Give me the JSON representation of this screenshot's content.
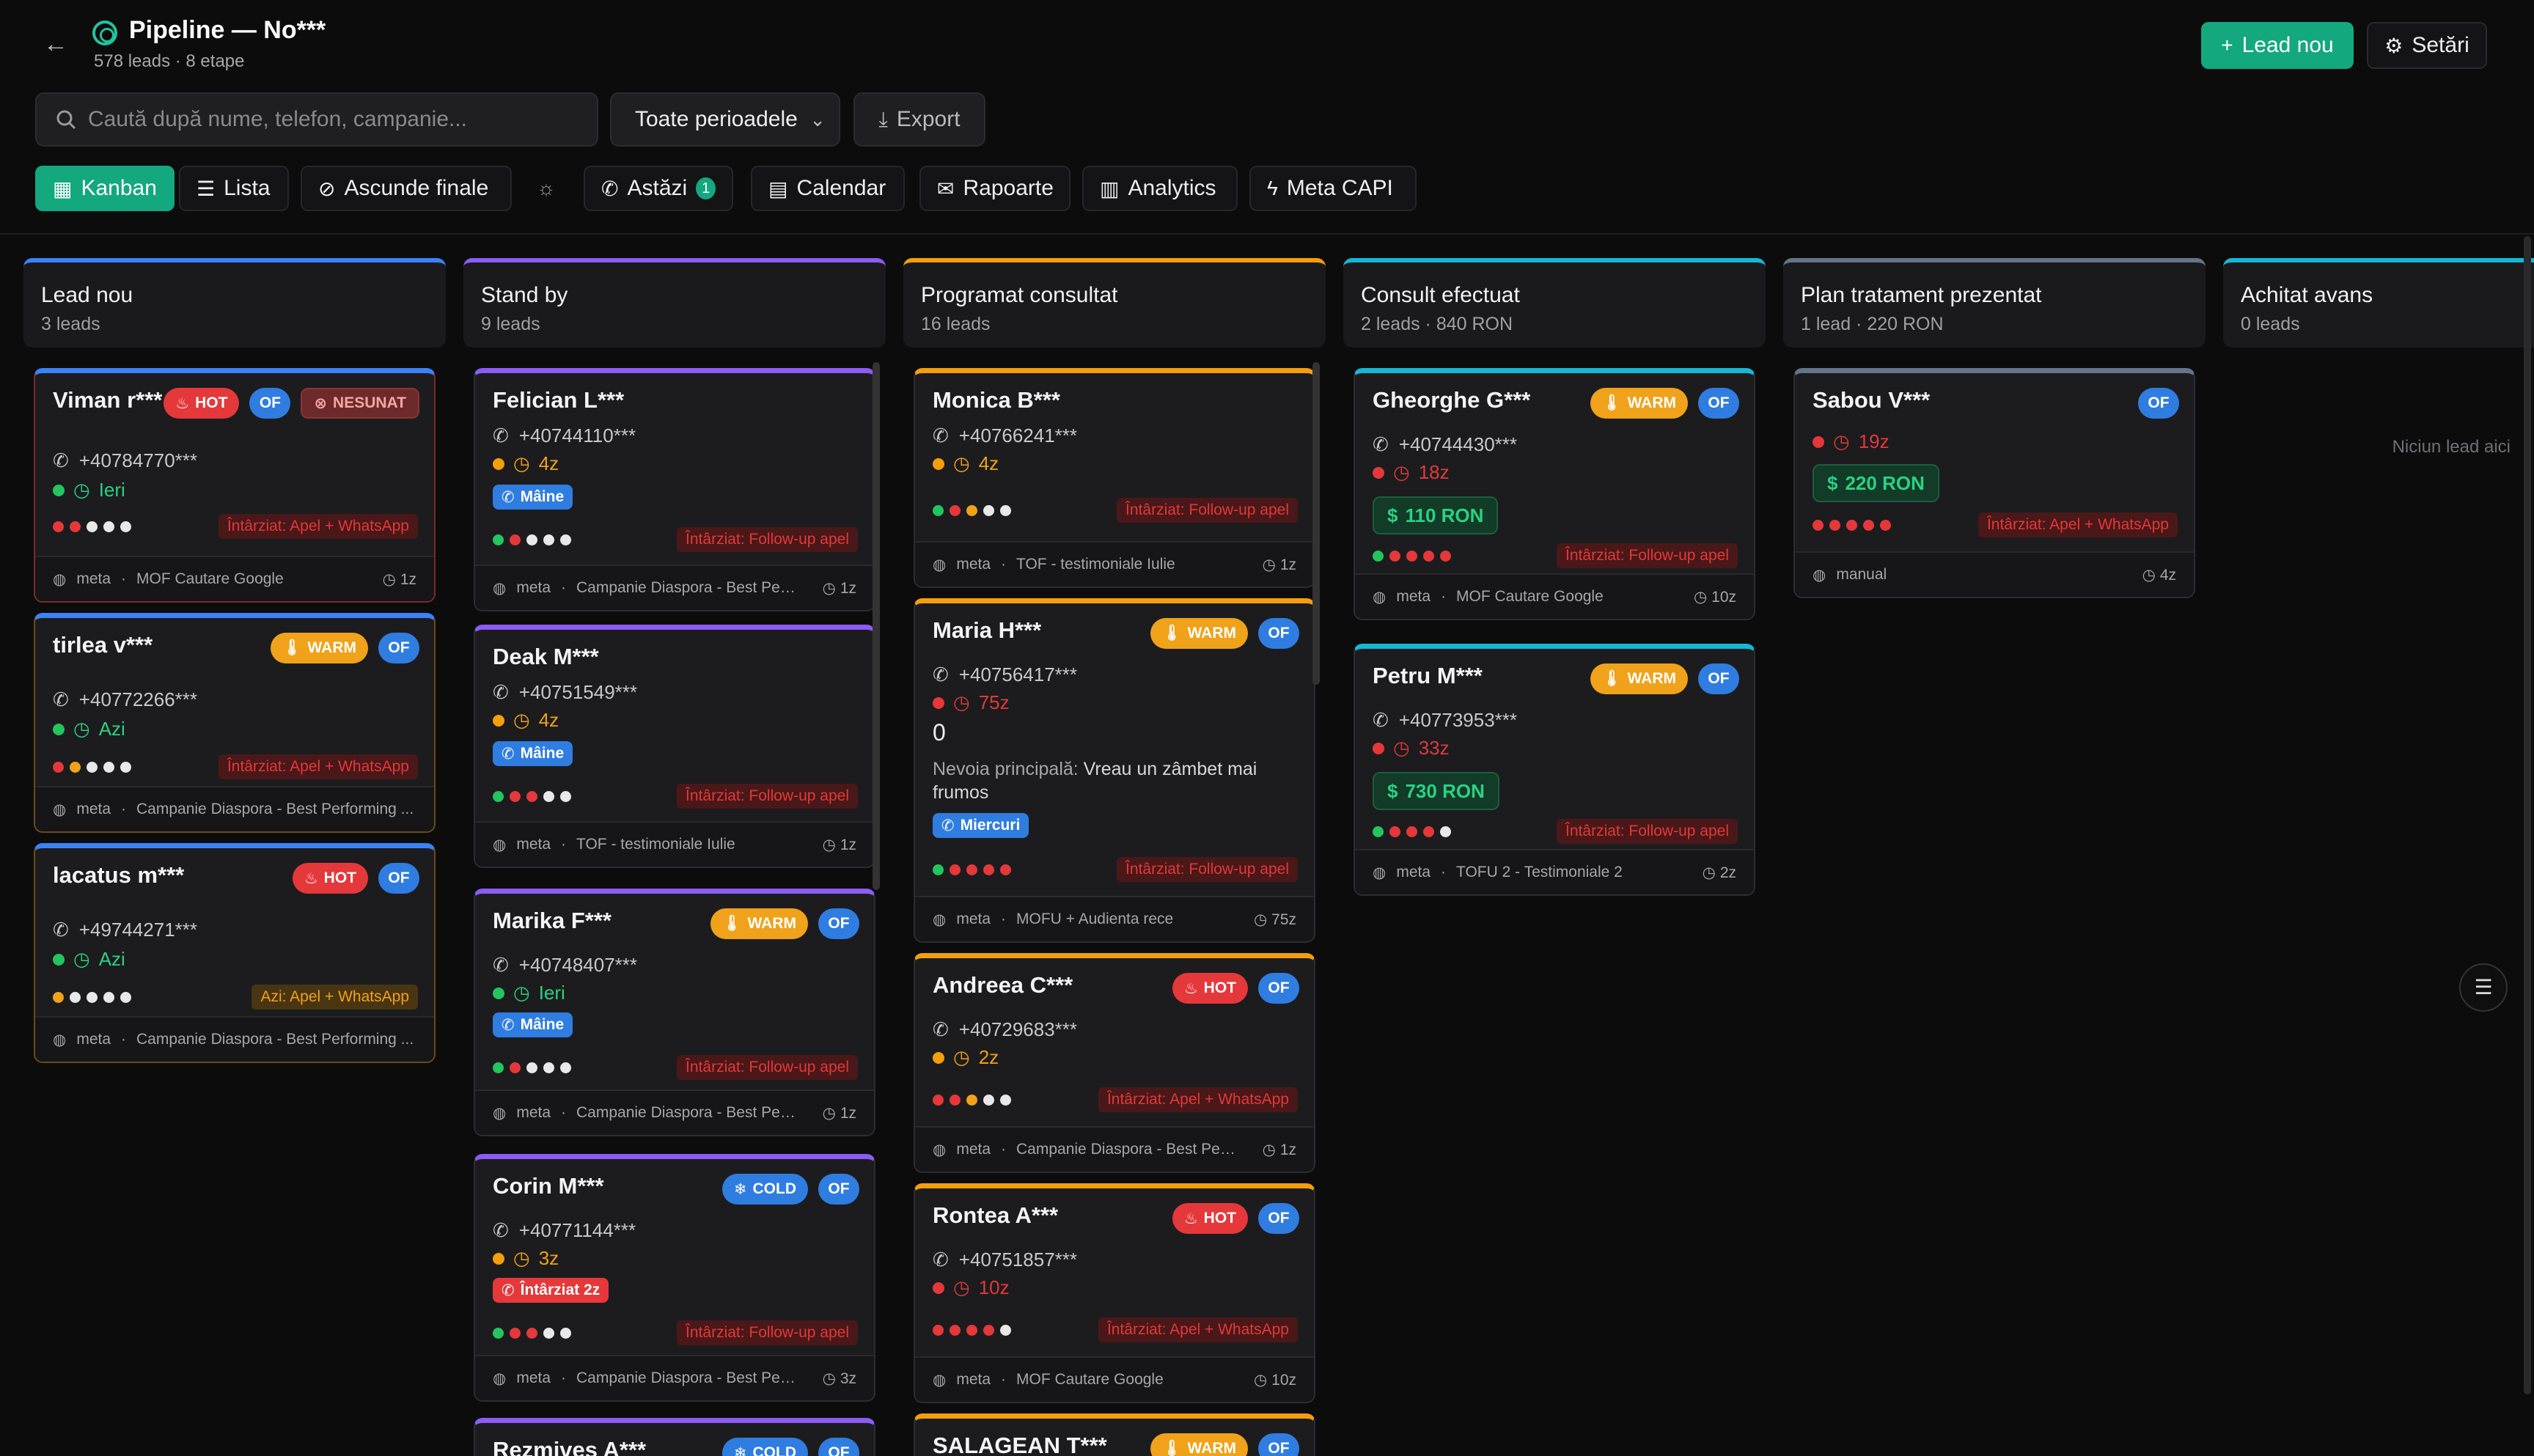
{
  "header": {
    "title": "Pipeline — No***",
    "subtitle": "578 leads · 8 etape",
    "new_lead": "Lead nou",
    "settings": "Setări"
  },
  "search": {
    "placeholder": "Caută după nume, telefon, campanie..."
  },
  "period": {
    "value": "Toate perioadele"
  },
  "export": "Export",
  "toolbar": {
    "kanban": "Kanban",
    "lista": "Lista",
    "hide": "Ascunde finale",
    "today": "Astăzi",
    "today_count": "1",
    "calendar": "Calendar",
    "reports": "Rapoarte",
    "analytics": "Analytics",
    "meta": "Meta CAPI"
  },
  "columns": [
    {
      "title": "Lead nou",
      "sub": "3 leads",
      "color": "#3b82f6"
    },
    {
      "title": "Stand by",
      "sub": "9 leads",
      "color": "#8b5cf6"
    },
    {
      "title": "Programat consultat",
      "sub": "16 leads",
      "color": "#f59e0b"
    },
    {
      "title": "Consult efectuat",
      "sub": "2 leads · 840 RON",
      "color": "#14b8d4"
    },
    {
      "title": "Plan tratament prezentat",
      "sub": "1 lead · 220 RON",
      "color": "#64748b"
    },
    {
      "title": "Achitat avans",
      "sub": "0 leads",
      "color": "#14b8d4"
    }
  ],
  "empty": "Niciun lead aici",
  "cards": {
    "c1": {
      "name": "Viman r***",
      "hot": "HOT",
      "of": "OF",
      "nes": "NESUNAT",
      "phone": "+40784770***",
      "time": "Ieri",
      "alert": "Întârziat: Apel + WhatsApp",
      "src": "meta",
      "camp": "MOF Cautare Google",
      "age": "1z"
    },
    "c2": {
      "name": "tirlea v***",
      "warm": "WARM",
      "of": "OF",
      "phone": "+40772266***",
      "time": "Azi",
      "alert": "Întârziat: Apel + WhatsApp",
      "src": "meta",
      "camp": "Campanie Diaspora - Best Performing ...",
      "age": ""
    },
    "c3": {
      "name": "lacatus m***",
      "hot": "HOT",
      "of": "OF",
      "phone": "+49744271***",
      "time": "Azi",
      "alert": "Azi: Apel + WhatsApp",
      "src": "meta",
      "camp": "Campanie Diaspora - Best Performing ...",
      "age": ""
    },
    "s1": {
      "name": "Felician L***",
      "phone": "+40744110***",
      "time": "4z",
      "pill": "Mâine",
      "alert": "Întârziat: Follow-up apel",
      "src": "meta",
      "camp": "Campanie Diaspora - Best Perf...",
      "age": "1z"
    },
    "s2": {
      "name": "Deak M***",
      "phone": "+40751549***",
      "time": "4z",
      "pill": "Mâine",
      "alert": "Întârziat: Follow-up apel",
      "src": "meta",
      "camp": "TOF - testimoniale Iulie",
      "age": "1z"
    },
    "s3": {
      "name": "Marika F***",
      "warm": "WARM",
      "of": "OF",
      "phone": "+40748407***",
      "time": "Ieri",
      "pill": "Mâine",
      "alert": "Întârziat: Follow-up apel",
      "src": "meta",
      "camp": "Campanie Diaspora - Best Perf...",
      "age": "1z"
    },
    "s4": {
      "name": "Corin M***",
      "cold": "COLD",
      "of": "OF",
      "phone": "+40771144***",
      "time": "3z",
      "pill": "Întârziat 2z",
      "alert": "Întârziat: Follow-up apel",
      "src": "meta",
      "camp": "Campanie Diaspora - Best Per...",
      "age": "3z"
    },
    "s5": {
      "name": "Rezmives A***",
      "cold": "COLD",
      "of": "OF"
    },
    "p1": {
      "name": "Monica B***",
      "phone": "+40766241***",
      "time": "4z",
      "alert": "Întârziat: Follow-up apel",
      "src": "meta",
      "camp": "TOF - testimoniale Iulie",
      "age": "1z"
    },
    "p2": {
      "name": "Maria H***",
      "warm": "WARM",
      "of": "OF",
      "phone": "+40756417***",
      "time": "75z",
      "zero": "0",
      "need_label": "Nevoia principală:",
      "need": "Vreau un zâmbet mai frumos",
      "pill": "Miercuri",
      "alert": "Întârziat: Follow-up apel",
      "src": "meta",
      "camp": "MOFU + Audienta rece",
      "age": "75z"
    },
    "p3": {
      "name": "Andreea C***",
      "hot": "HOT",
      "of": "OF",
      "phone": "+40729683***",
      "time": "2z",
      "alert": "Întârziat: Apel + WhatsApp",
      "src": "meta",
      "camp": "Campanie Diaspora - Best Perf...",
      "age": "1z"
    },
    "p4": {
      "name": "Rontea A***",
      "hot": "HOT",
      "of": "OF",
      "phone": "+40751857***",
      "time": "10z",
      "alert": "Întârziat: Apel + WhatsApp",
      "src": "meta",
      "camp": "MOF Cautare Google",
      "age": "10z"
    },
    "p5": {
      "name": "SALAGEAN T***",
      "warm": "WARM",
      "of": "OF"
    },
    "e1": {
      "name": "Gheorghe G***",
      "warm": "WARM",
      "of": "OF",
      "phone": "+40744430***",
      "time": "18z",
      "amount": "110 RON",
      "alert": "Întârziat: Follow-up apel",
      "src": "meta",
      "camp": "MOF Cautare Google",
      "age": "10z"
    },
    "e2": {
      "name": "Petru M***",
      "warm": "WARM",
      "of": "OF",
      "phone": "+40773953***",
      "time": "33z",
      "amount": "730 RON",
      "alert": "Întârziat: Follow-up apel",
      "src": "meta",
      "camp": "TOFU 2 - Testimoniale 2",
      "age": "2z"
    },
    "t1": {
      "name": "Sabou V***",
      "of": "OF",
      "time": "19z",
      "amount": "220 RON",
      "alert": "Întârziat: Apel + WhatsApp",
      "src": "manual",
      "age": "4z"
    }
  }
}
